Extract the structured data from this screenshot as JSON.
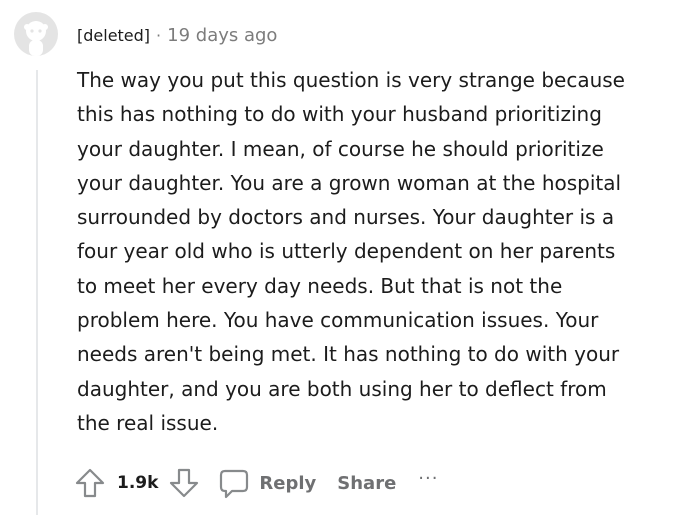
{
  "comment": {
    "author": "[deleted]",
    "separator": "·",
    "time_ago": "19 days ago",
    "body": "The way you put this question is very strange because\nthis has nothing to do with your husband prioritizing\nyour daughter. I mean, of course he should prioritize\nyour daughter. You are a grown woman at the hospital\nsurrounded by doctors and nurses. Your daughter is a\nfour year old who is utterly dependent on her parents\nto meet her every day needs. But that is not the\nproblem here. You have communication issues. Your\nneeds aren't being met. It has nothing to do with your\ndaughter, and you are both using her to deflect from\nthe real issue."
  },
  "actions": {
    "vote_count": "1.9k",
    "reply_label": "Reply",
    "share_label": "Share",
    "more_label": "···"
  },
  "icons": {
    "avatar": "deleted-user-avatar-icon",
    "upvote": "upvote-arrow-icon",
    "downvote": "downvote-arrow-icon",
    "reply": "comment-bubble-icon",
    "more": "more-options-icon"
  },
  "colors": {
    "text": "#1c1c1c",
    "meta": "#7c7c7c",
    "action": "#6f7072",
    "icon": "#878a8c",
    "avatar_bg": "#e4e4e4",
    "avatar_fg": "#ffffff",
    "thread_line": "#e6e8ea"
  }
}
